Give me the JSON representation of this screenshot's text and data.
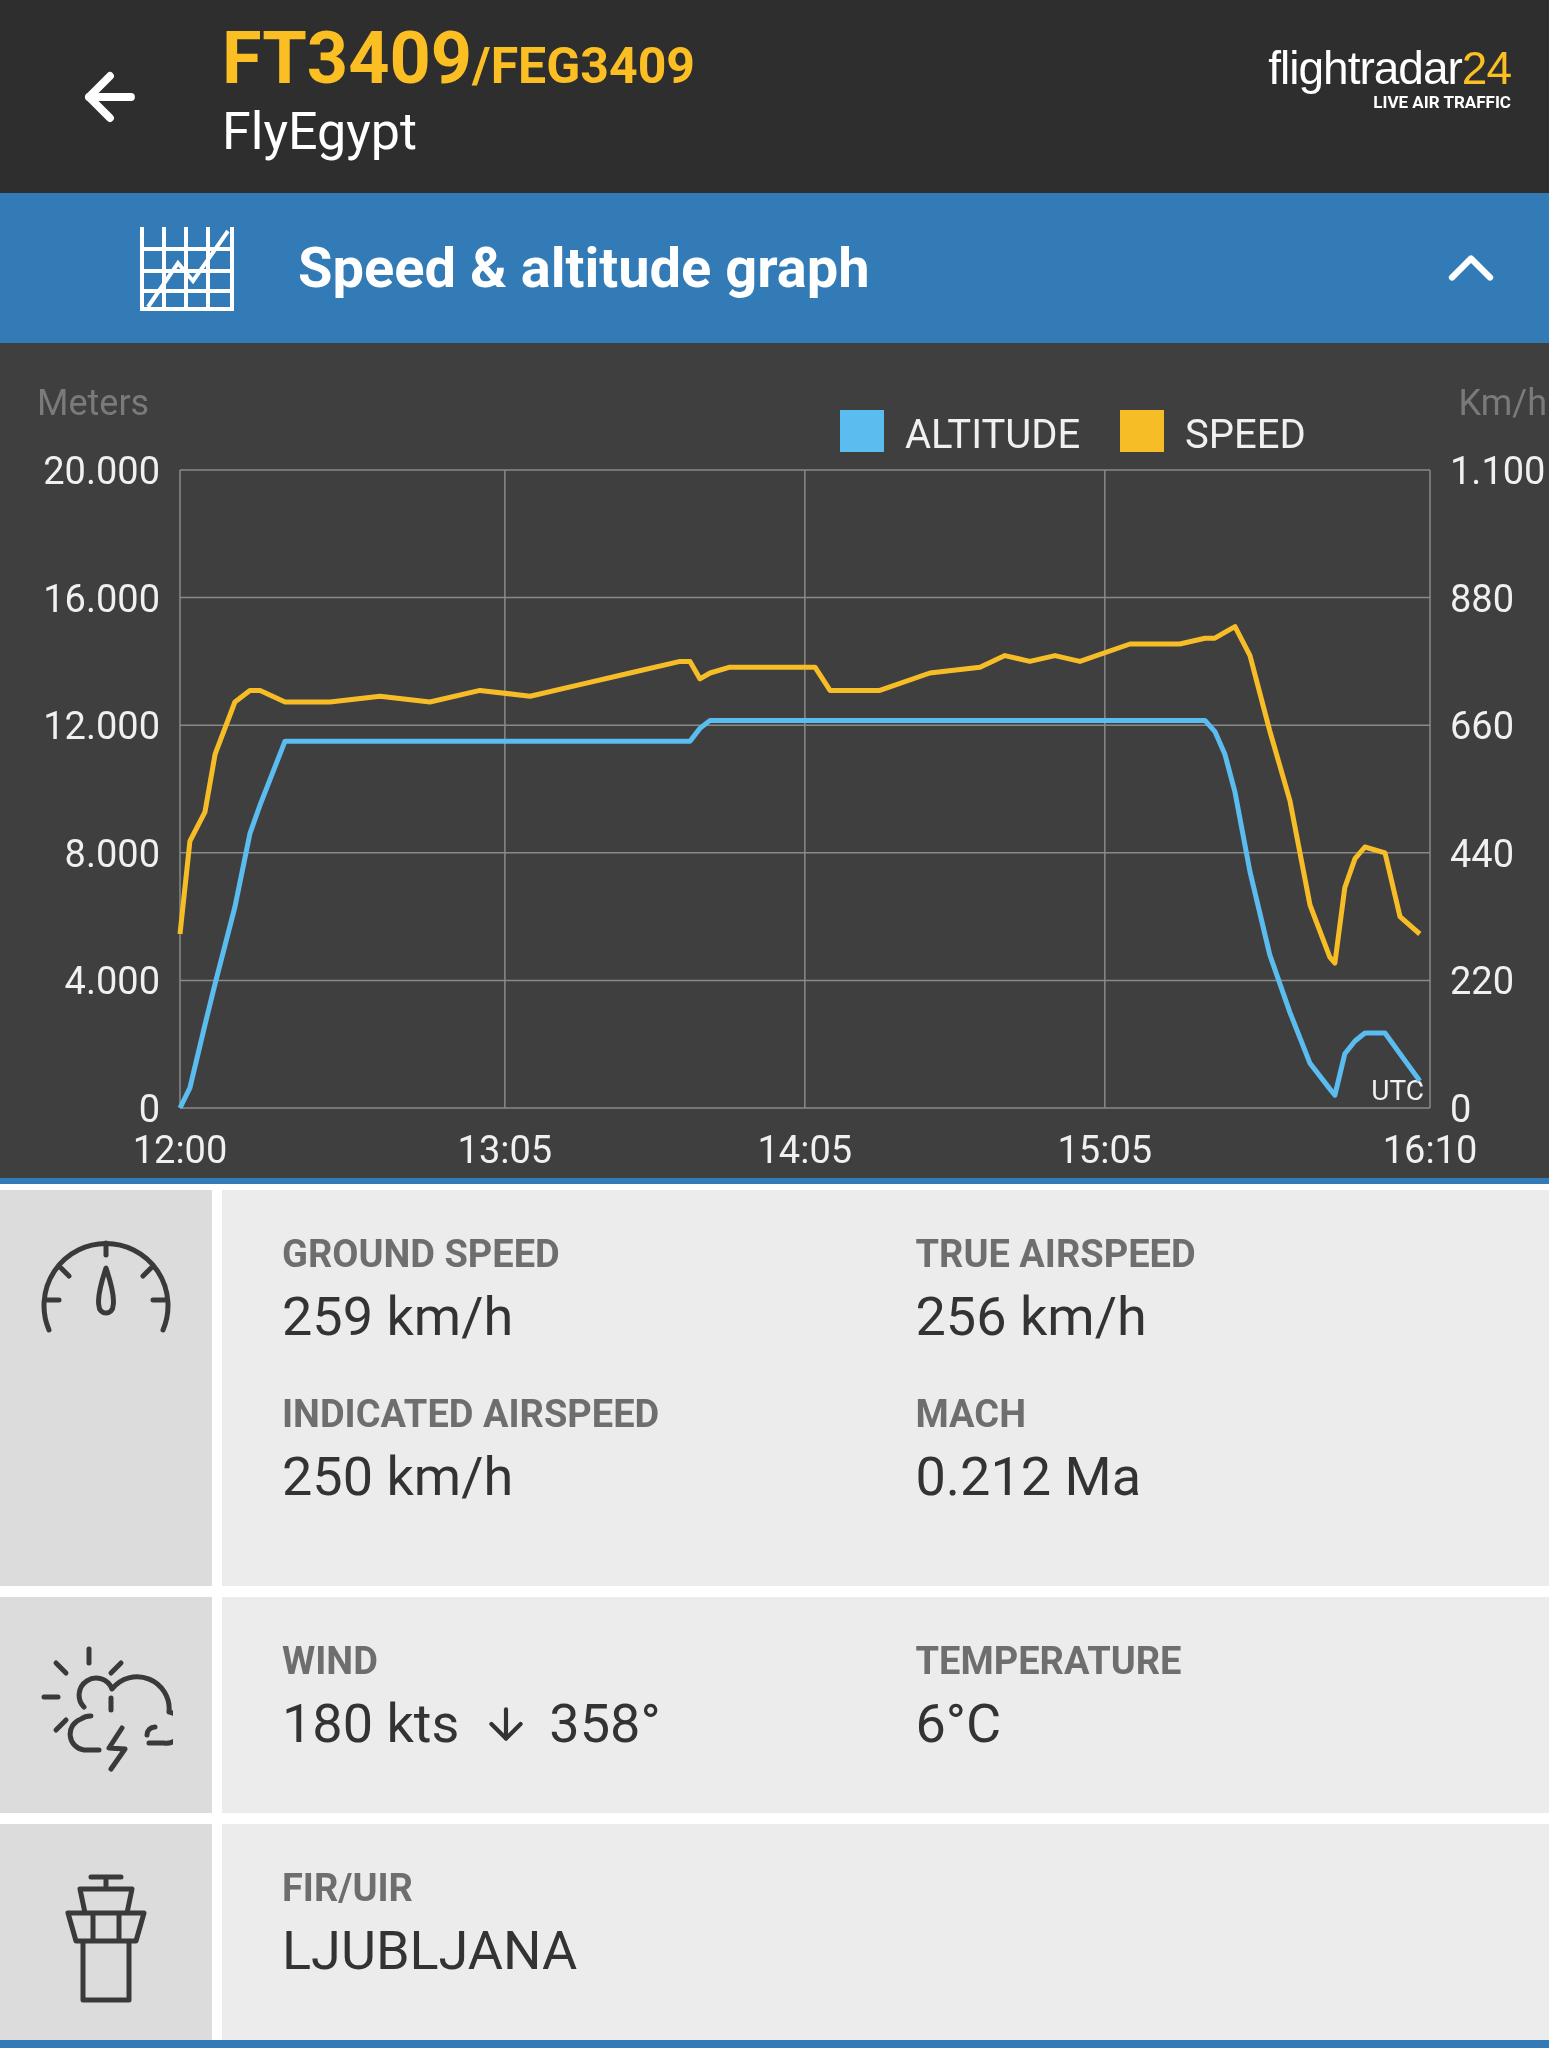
{
  "header": {
    "flight_number": "FT3409",
    "callsign": "/FEG3409",
    "airline": "FlyEgypt",
    "logo": {
      "name": "flightradar",
      "number": "24",
      "tagline": "LIVE AIR TRAFFIC"
    }
  },
  "panel": {
    "title": "Speed & altitude graph",
    "expanded": true
  },
  "chart_data": {
    "type": "line",
    "grid": true,
    "legend": "top",
    "ylabel": "Meters",
    "y2label": "Km/h",
    "xlabel": "UTC",
    "x": [
      12,
      12.033,
      12.083,
      12.117,
      12.183,
      12.233,
      12.267,
      12.35,
      12.5,
      12.667,
      12.833,
      13,
      13.167,
      13.333,
      13.5,
      13.667,
      13.7,
      13.733,
      13.767,
      13.833,
      14,
      14.117,
      14.167,
      14.333,
      14.5,
      14.667,
      14.75,
      14.833,
      14.917,
      15,
      15.167,
      15.333,
      15.417,
      15.45,
      15.483,
      15.517,
      15.567,
      15.633,
      15.7,
      15.767,
      15.833,
      15.85,
      15.883,
      15.917,
      15.95,
      16.017,
      16.067,
      16.133
    ],
    "xlim": [
      12,
      16.167
    ],
    "xticks": [
      {
        "value": 12,
        "label": "12:00"
      },
      {
        "value": 13.083,
        "label": "13:05"
      },
      {
        "value": 14.083,
        "label": "14:05"
      },
      {
        "value": 15.083,
        "label": "15:05"
      },
      {
        "value": 16.167,
        "label": "16:10"
      }
    ],
    "ylim": [
      0,
      20
    ],
    "yticks": [
      {
        "value": 0,
        "label": "0"
      },
      {
        "value": 4,
        "label": "4.000"
      },
      {
        "value": 8,
        "label": "8.000"
      },
      {
        "value": 12,
        "label": "12.000"
      },
      {
        "value": 16,
        "label": "16.000"
      },
      {
        "value": 20,
        "label": "20.000"
      }
    ],
    "y2lim": [
      0,
      1100
    ],
    "y2ticks": [
      {
        "value": 0,
        "label": "0"
      },
      {
        "value": 220,
        "label": "220"
      },
      {
        "value": 440,
        "label": "440"
      },
      {
        "value": 660,
        "label": "660"
      },
      {
        "value": 880,
        "label": "880"
      },
      {
        "label": "1.100"
      }
    ],
    "series": [
      {
        "name": "ALTITUDE",
        "color": "#5bbcf0",
        "values": [
          0,
          0.63,
          2.6,
          3.9,
          6.3,
          8.6,
          9.5,
          11.5,
          11.5,
          11.5,
          11.5,
          11.5,
          11.5,
          11.5,
          11.5,
          11.5,
          11.5,
          11.9,
          12.15,
          12.15,
          12.15,
          12.15,
          12.15,
          12.15,
          12.15,
          12.15,
          12.15,
          12.15,
          12.15,
          12.15,
          12.15,
          12.15,
          12.15,
          11.8,
          11.1,
          9.9,
          7.4,
          4.8,
          3,
          1.4,
          0.6,
          0.4,
          1.7,
          2.1,
          2.35,
          2.35,
          1.7,
          0.85
        ]
      },
      {
        "name": "SPEED",
        "color": "#f6bd27",
        "axis": "y2",
        "values": [
          300,
          460,
          510,
          610,
          700,
          720,
          720,
          700,
          700,
          710,
          700,
          720,
          710,
          730,
          750,
          770,
          770,
          740,
          750,
          760,
          760,
          760,
          720,
          720,
          750,
          760,
          780,
          770,
          780,
          770,
          800,
          800,
          810,
          810,
          820,
          830,
          780,
          650,
          530,
          350,
          260,
          250,
          380,
          430,
          450,
          440,
          330,
          300
        ]
      }
    ]
  },
  "sections": [
    {
      "fields": [
        {
          "label": "GROUND SPEED",
          "value": "259 km/h"
        },
        {
          "label": "TRUE AIRSPEED",
          "value": "256 km/h"
        },
        {
          "label": "INDICATED AIRSPEED",
          "value": "250 km/h"
        },
        {
          "label": "MACH",
          "value": "0.212 Ma"
        }
      ]
    },
    {
      "fields": [
        {
          "label": "WIND",
          "value": "180 kts",
          "direction": "358°"
        },
        {
          "label": "TEMPERATURE",
          "value": "6°C"
        }
      ]
    },
    {
      "fields": [
        {
          "label": "FIR/UIR",
          "value": "LJUBLJANA"
        }
      ]
    }
  ]
}
